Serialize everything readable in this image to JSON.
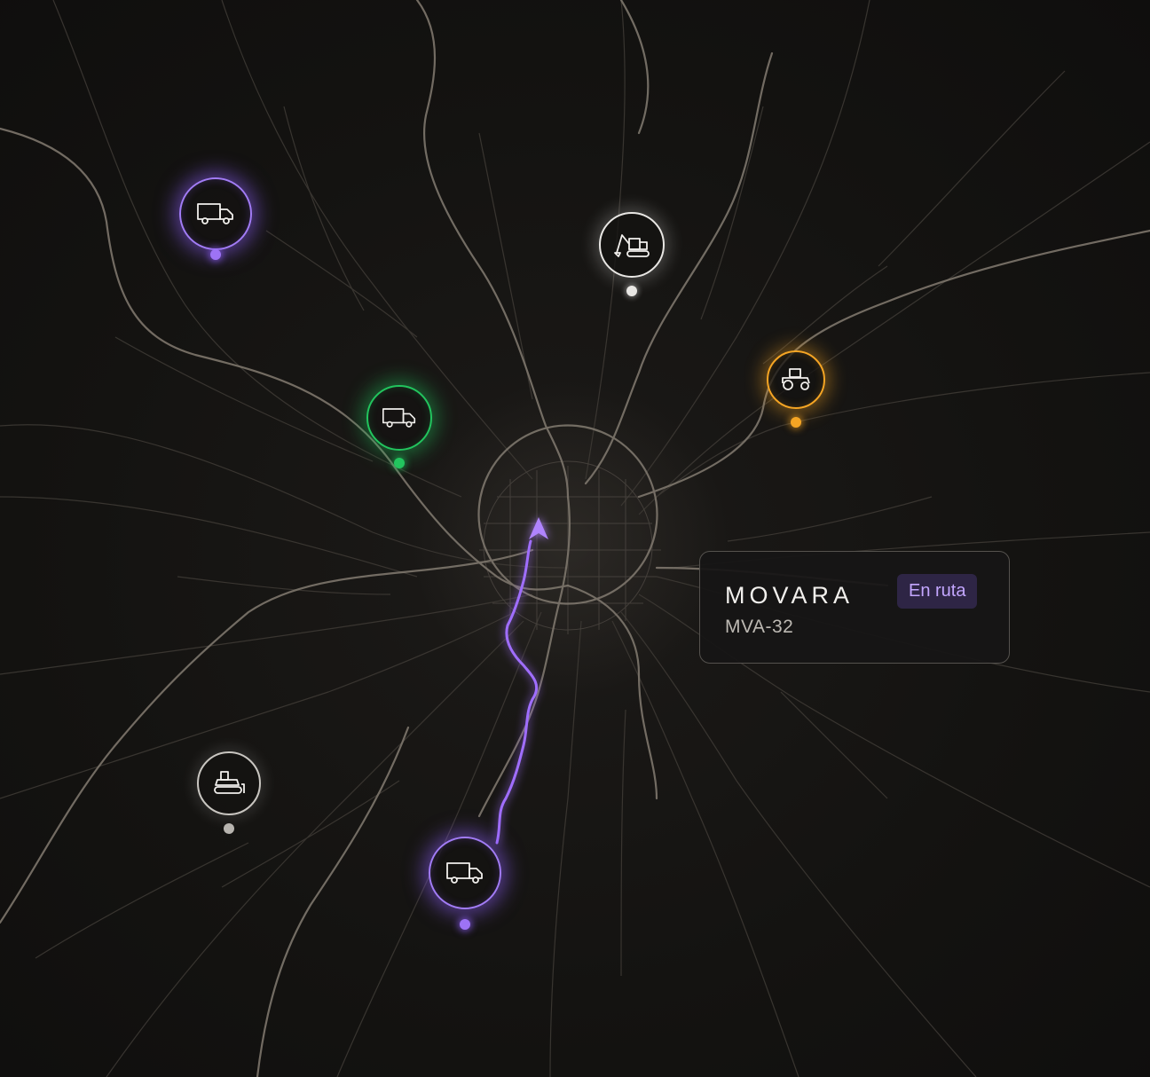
{
  "map": {
    "colors": {
      "background": "#141311",
      "road_major": "#8c8478",
      "road_minor": "#4a4540",
      "route": "#9b6bff"
    },
    "markers": [
      {
        "id": "truck-nw",
        "icon": "truck-icon",
        "status_color": "#9d73f5",
        "status": "purple"
      },
      {
        "id": "truck-west",
        "icon": "truck-icon",
        "status_color": "#22c55e",
        "status": "green"
      },
      {
        "id": "excavator-north",
        "icon": "excavator-icon",
        "status_color": "#e9e7e4",
        "status": "white"
      },
      {
        "id": "tractor-east",
        "icon": "tractor-icon",
        "status_color": "#f5a524",
        "status": "orange"
      },
      {
        "id": "bulldozer-sw",
        "icon": "bulldozer-icon",
        "status_color": "#b7b4af",
        "status": "gray"
      },
      {
        "id": "truck-south-active",
        "icon": "truck-icon",
        "status_color": "#9d73f5",
        "status": "purple"
      }
    ]
  },
  "card": {
    "brand": "MOVARA",
    "status_badge": "En ruta",
    "unit_id": "MVA-32",
    "badge_color": "#c3a6ff"
  }
}
